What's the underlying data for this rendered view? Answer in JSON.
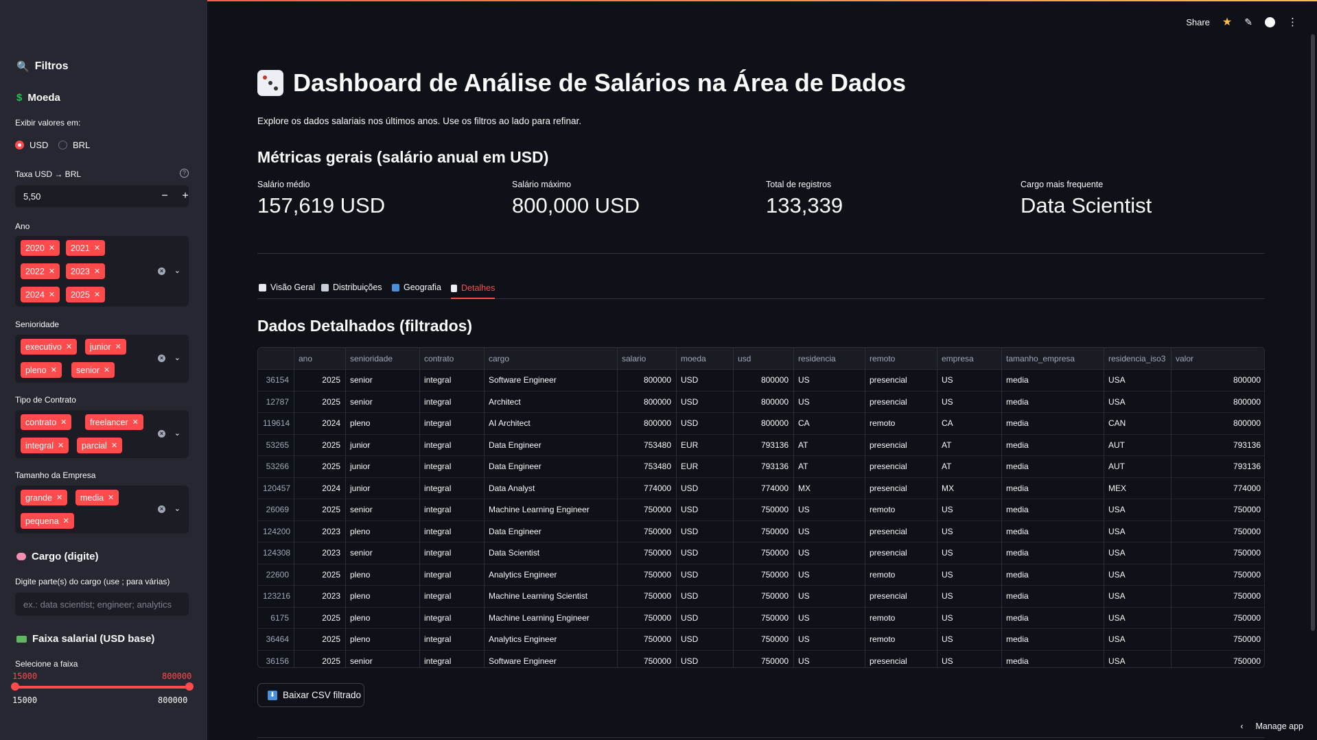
{
  "header": {
    "share_label": "Share"
  },
  "sidebar": {
    "filters_title": "Filtros",
    "currency": {
      "title": "Moeda",
      "show_values_label": "Exibir valores em:",
      "options": [
        "USD",
        "BRL"
      ],
      "selected": "USD",
      "rate_label": "Taxa USD → BRL",
      "rate_value": "5,50",
      "minus": "−",
      "plus": "+"
    },
    "ano": {
      "label": "Ano",
      "tags": [
        "2020",
        "2021",
        "2022",
        "2023",
        "2024",
        "2025"
      ]
    },
    "senioridade": {
      "label": "Senioridade",
      "tags": [
        "executivo",
        "junior",
        "pleno",
        "senior"
      ]
    },
    "contrato": {
      "label": "Tipo de Contrato",
      "tags": [
        "contrato",
        "freelancer",
        "integral",
        "parcial"
      ]
    },
    "tamanho": {
      "label": "Tamanho da Empresa",
      "tags": [
        "grande",
        "media",
        "pequena"
      ]
    },
    "cargo": {
      "title": "Cargo (digite)",
      "input_label": "Digite parte(s) do cargo (use ; para várias)",
      "placeholder": "ex.: data scientist; engineer; analytics"
    },
    "faixa": {
      "title": "Faixa salarial (USD base)",
      "label": "Selecione a faixa",
      "low": "15000",
      "high": "800000",
      "min": "15000",
      "max": "800000"
    }
  },
  "main": {
    "title": "Dashboard de Análise de Salários na Área de Dados",
    "subtitle": "Explore os dados salariais nos últimos anos. Use os filtros ao lado para refinar.",
    "metrics_title": "Métricas gerais (salário anual em USD)",
    "metrics": [
      {
        "label": "Salário médio",
        "value": "157,619 USD"
      },
      {
        "label": "Salário máximo",
        "value": "800,000 USD"
      },
      {
        "label": "Total de registros",
        "value": "133,339"
      },
      {
        "label": "Cargo mais frequente",
        "value": "Data Scientist"
      }
    ],
    "tabs": [
      "Visão Geral",
      "Distribuições",
      "Geografia",
      "Detalhes"
    ],
    "active_tab": "Detalhes",
    "detail_title": "Dados Detalhados (filtrados)",
    "download_label": "Baixar CSV filtrado"
  },
  "table": {
    "columns": [
      "",
      "ano",
      "senioridade",
      "contrato",
      "cargo",
      "salario",
      "moeda",
      "usd",
      "residencia",
      "remoto",
      "empresa",
      "tamanho_empresa",
      "residencia_iso3",
      "valor"
    ],
    "rows": [
      [
        "36154",
        "2025",
        "senior",
        "integral",
        "Software Engineer",
        "800000",
        "USD",
        "800000",
        "US",
        "presencial",
        "US",
        "media",
        "USA",
        "800000"
      ],
      [
        "12787",
        "2025",
        "senior",
        "integral",
        "Architect",
        "800000",
        "USD",
        "800000",
        "US",
        "presencial",
        "US",
        "media",
        "USA",
        "800000"
      ],
      [
        "119614",
        "2024",
        "pleno",
        "integral",
        "AI Architect",
        "800000",
        "USD",
        "800000",
        "CA",
        "remoto",
        "CA",
        "media",
        "CAN",
        "800000"
      ],
      [
        "53265",
        "2025",
        "junior",
        "integral",
        "Data Engineer",
        "753480",
        "EUR",
        "793136",
        "AT",
        "presencial",
        "AT",
        "media",
        "AUT",
        "793136"
      ],
      [
        "53266",
        "2025",
        "junior",
        "integral",
        "Data Engineer",
        "753480",
        "EUR",
        "793136",
        "AT",
        "presencial",
        "AT",
        "media",
        "AUT",
        "793136"
      ],
      [
        "120457",
        "2024",
        "junior",
        "integral",
        "Data Analyst",
        "774000",
        "USD",
        "774000",
        "MX",
        "presencial",
        "MX",
        "media",
        "MEX",
        "774000"
      ],
      [
        "26069",
        "2025",
        "senior",
        "integral",
        "Machine Learning Engineer",
        "750000",
        "USD",
        "750000",
        "US",
        "remoto",
        "US",
        "media",
        "USA",
        "750000"
      ],
      [
        "124200",
        "2023",
        "pleno",
        "integral",
        "Data Engineer",
        "750000",
        "USD",
        "750000",
        "US",
        "presencial",
        "US",
        "media",
        "USA",
        "750000"
      ],
      [
        "124308",
        "2023",
        "senior",
        "integral",
        "Data Scientist",
        "750000",
        "USD",
        "750000",
        "US",
        "presencial",
        "US",
        "media",
        "USA",
        "750000"
      ],
      [
        "22600",
        "2025",
        "pleno",
        "integral",
        "Analytics Engineer",
        "750000",
        "USD",
        "750000",
        "US",
        "remoto",
        "US",
        "media",
        "USA",
        "750000"
      ],
      [
        "123216",
        "2023",
        "pleno",
        "integral",
        "Machine Learning Scientist",
        "750000",
        "USD",
        "750000",
        "US",
        "presencial",
        "US",
        "media",
        "USA",
        "750000"
      ],
      [
        "6175",
        "2025",
        "pleno",
        "integral",
        "Machine Learning Engineer",
        "750000",
        "USD",
        "750000",
        "US",
        "remoto",
        "US",
        "media",
        "USA",
        "750000"
      ],
      [
        "36464",
        "2025",
        "pleno",
        "integral",
        "Analytics Engineer",
        "750000",
        "USD",
        "750000",
        "US",
        "remoto",
        "US",
        "media",
        "USA",
        "750000"
      ],
      [
        "36156",
        "2025",
        "senior",
        "integral",
        "Software Engineer",
        "750000",
        "USD",
        "750000",
        "US",
        "presencial",
        "US",
        "media",
        "USA",
        "750000"
      ]
    ]
  },
  "footer": {
    "manage_label": "Manage app"
  },
  "colors": {
    "accent": "#ff4b4b",
    "background": "#0e1117",
    "sidebar": "#262730"
  },
  "icons": [
    "magnifier-icon",
    "dollar-icon",
    "dice-icon",
    "brain-icon",
    "money-icon",
    "download-icon",
    "star-icon",
    "pencil-icon",
    "github-icon",
    "kebab-icon",
    "chevron-left-icon"
  ]
}
